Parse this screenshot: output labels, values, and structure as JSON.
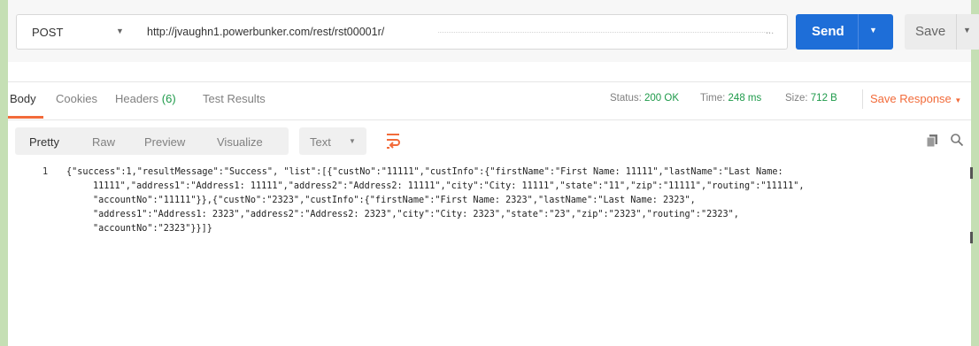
{
  "request": {
    "method": "POST",
    "url": "http://jvaughn1.powerbunker.com/rest/rst00001r/",
    "url_overflow": "...",
    "send_label": "Send",
    "save_label": "Save"
  },
  "response_tabs": [
    {
      "label": "Body",
      "active": true
    },
    {
      "label": "Cookies",
      "active": false
    },
    {
      "label": "Headers",
      "count": "(6)",
      "active": false
    },
    {
      "label": "Test Results",
      "active": false
    }
  ],
  "status": {
    "status_label": "Status:",
    "status_value": "200 OK",
    "time_label": "Time:",
    "time_value": "248 ms",
    "size_label": "Size:",
    "size_value": "712 B",
    "save_response_label": "Save Response"
  },
  "format_tabs": [
    {
      "label": "Pretty",
      "active": true
    },
    {
      "label": "Raw",
      "active": false
    },
    {
      "label": "Preview",
      "active": false
    },
    {
      "label": "Visualize",
      "active": false
    }
  ],
  "text_type": "Text",
  "icons": {
    "chevron": "chevron-down-icon",
    "wrap": "word-wrap-icon",
    "copy": "copy-icon",
    "search": "search-icon"
  },
  "colors": {
    "send": "#1e6ed8",
    "accent": "#f26b3a",
    "status_green": "#1e9a4a",
    "background": "#c5dfb4"
  },
  "code": {
    "line_number": "1",
    "lines": [
      "{\"success\":1,\"resultMessage\":\"Success\", \"list\":[{\"custNo\":\"11111\",\"custInfo\":{\"firstName\":\"First Name: 11111\",\"lastName\":\"Last Name:",
      "11111\",\"address1\":\"Address1: 11111\",\"address2\":\"Address2: 11111\",\"city\":\"City: 11111\",\"state\":\"11\",\"zip\":\"11111\",\"routing\":\"11111\",",
      "\"accountNo\":\"11111\"}},{\"custNo\":\"2323\",\"custInfo\":{\"firstName\":\"First Name: 2323\",\"lastName\":\"Last Name: 2323\",",
      "\"address1\":\"Address1: 2323\",\"address2\":\"Address2: 2323\",\"city\":\"City: 2323\",\"state\":\"23\",\"zip\":\"2323\",\"routing\":\"2323\",",
      "\"accountNo\":\"2323\"}}]}"
    ]
  }
}
